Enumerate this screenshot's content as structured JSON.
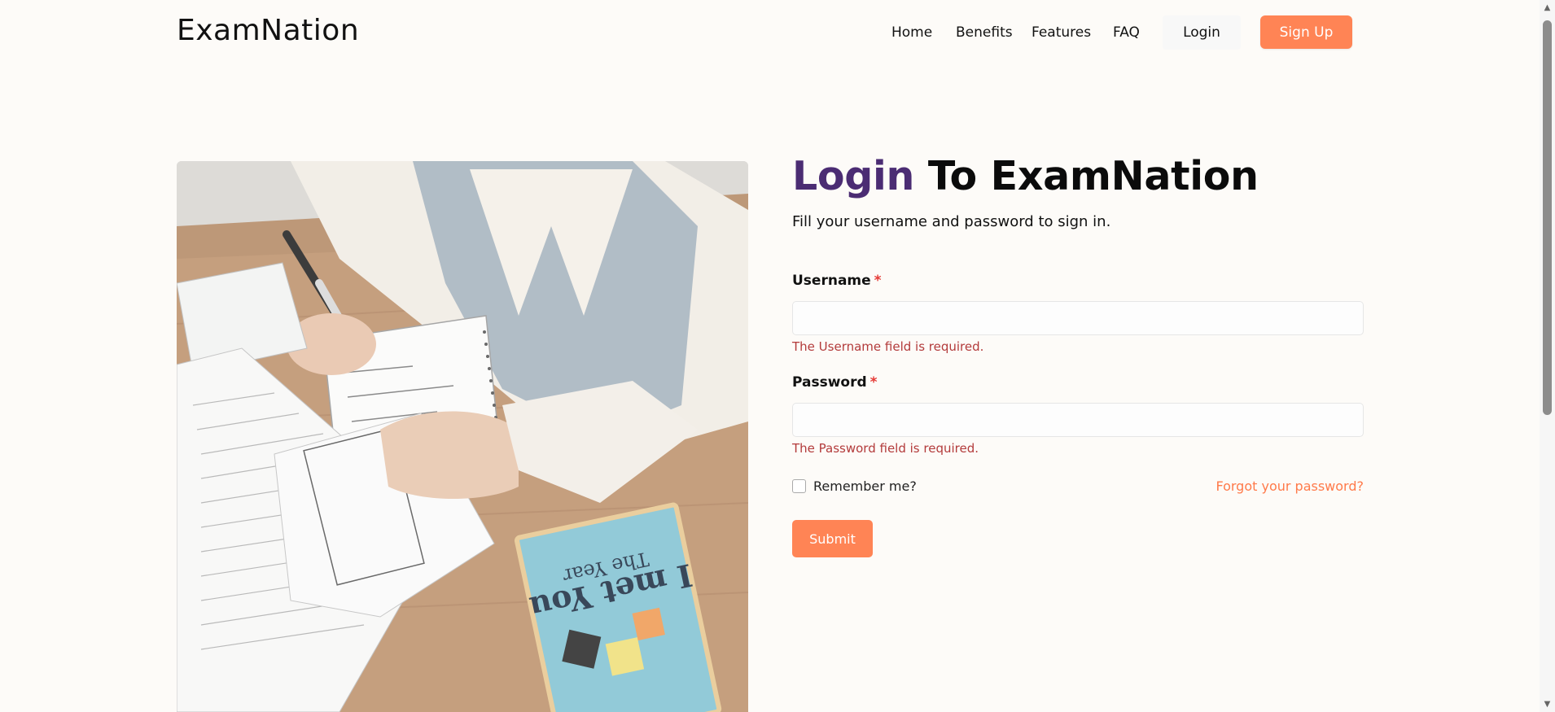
{
  "header": {
    "brand": "ExamNation",
    "nav": {
      "home": "Home",
      "benefits": "Benefits",
      "features": "Features",
      "faq": "FAQ"
    },
    "login_label": "Login",
    "signup_label": "Sign Up"
  },
  "form": {
    "title_accent": "Login",
    "title_rest": "To ExamNation",
    "subtitle": "Fill your username and password to sign in.",
    "username": {
      "label": "Username",
      "required_mark": "*",
      "value": "",
      "error": "The Username field is required."
    },
    "password": {
      "label": "Password",
      "required_mark": "*",
      "value": "",
      "error": "The Password field is required."
    },
    "remember_label": "Remember me?",
    "forgot_label": "Forgot your password?",
    "submit_label": "Submit"
  },
  "colors": {
    "accent_orange": "#ff8455",
    "title_purple": "#4b2c73",
    "error_red": "#b33b3b",
    "required_red": "#e53935",
    "background": "#fdfbf8"
  },
  "image": {
    "book_title_line1": "The Year",
    "book_title_line2": "I met You"
  }
}
